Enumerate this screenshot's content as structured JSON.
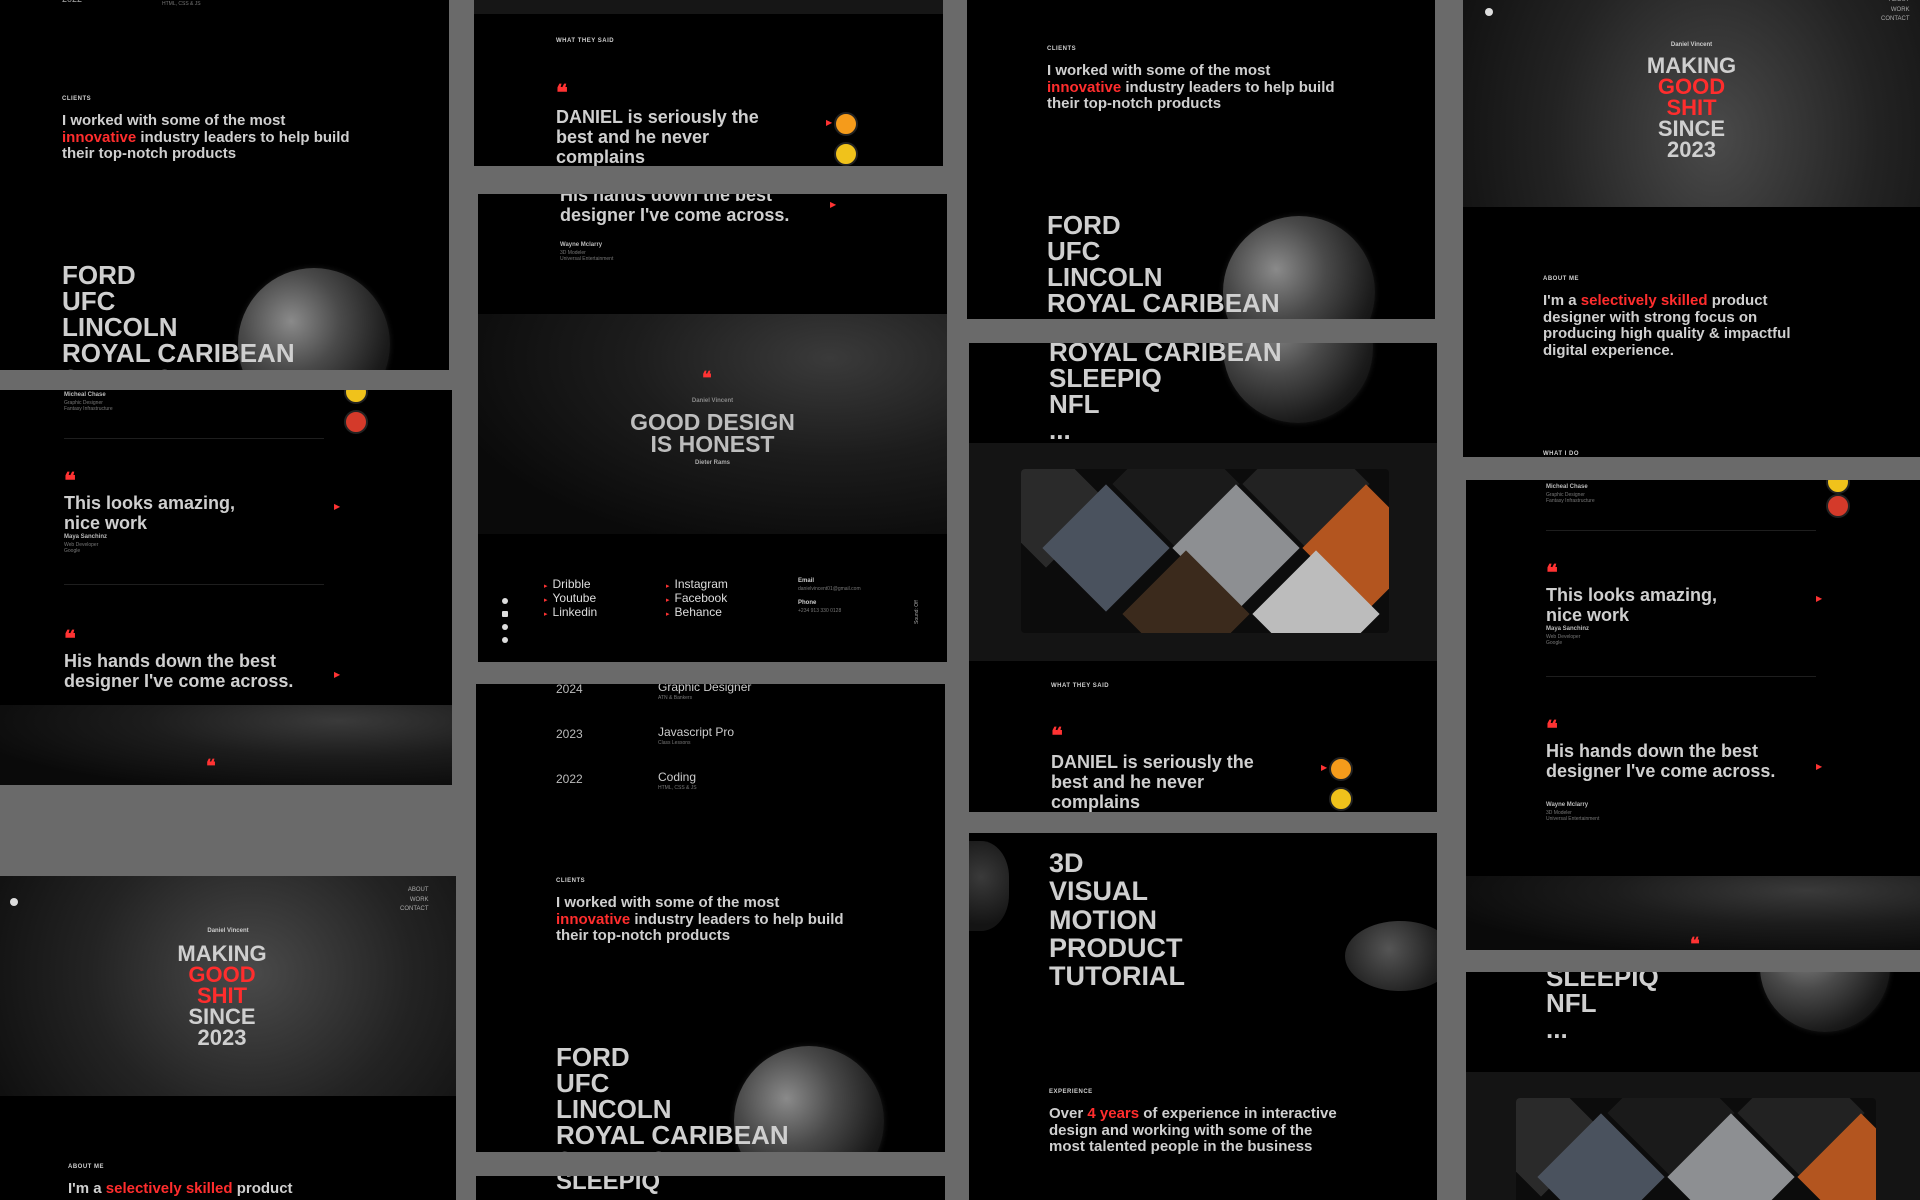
{
  "name": "Daniel Vincent",
  "labels": {
    "clients": "CLIENTS",
    "testimonials": "WHAT THEY SAID",
    "about": "ABOUT ME",
    "what_i_do": "WHAT I DO",
    "experience": "EXPERIENCE"
  },
  "clients_intro": {
    "pre": "I worked with some of the most",
    "highlight": "innovative",
    "post": "industry leaders to help build their top-notch products"
  },
  "clients": [
    "FORD",
    "UFC",
    "LINCOLN",
    "ROYAL CARIBEAN",
    "SLEEPIQ",
    "NFL"
  ],
  "ellipsis": "...",
  "quote_bits": {
    "daniel": "DANIEL is seriously the best and he never complains",
    "amazing": "This looks amazing, nice work",
    "best": "His hands down the best designer I've come across."
  },
  "people": {
    "micheal": {
      "name": "Micheal Chase",
      "role": "Graphic Designer",
      "company": "Fantasy Infrastructure"
    },
    "maya": {
      "name": "Maya Sanchinz",
      "role": "Web Developer",
      "company": "Google"
    },
    "wayne": {
      "name": "Wayne Mclarry",
      "role": "3D Modeler",
      "company": "Universal Entertainment"
    }
  },
  "motto": {
    "line1": "GOOD DESIGN",
    "line2": "IS HONEST",
    "author": "Dieter Rams"
  },
  "footer": {
    "col1": [
      "Dribble",
      "Youtube",
      "Linkedin"
    ],
    "col2": [
      "Instagram",
      "Facebook",
      "Behance"
    ],
    "email_label": "Email",
    "email": "danielvincent01@gmail.com",
    "phone_label": "Phone",
    "phone": "+234 913 330 0128",
    "sound": "Sound: Off"
  },
  "timeline": [
    {
      "year": "2024",
      "title": "Graphic Designer",
      "sub": "ATN & Bankers"
    },
    {
      "year": "2023",
      "title": "Javascript Pro",
      "sub": "Class Lessons"
    },
    {
      "year": "2022",
      "title": "Coding",
      "sub": "HTML, CSS & JS"
    }
  ],
  "top_fragment": {
    "year": "2022",
    "sub": "HTML, CSS & JS"
  },
  "hero": {
    "making": "MAKING",
    "good": "GOOD",
    "shit": "SHIT",
    "since": "SINCE",
    "year": "2023"
  },
  "nav": [
    "ABOUT",
    "WORK",
    "CONTACT"
  ],
  "about": {
    "pre": "I'm a",
    "highlight": "selectively skilled",
    "post": "product designer with strong focus on producing high quality & impactful digital experience."
  },
  "about_short": {
    "pre": "I'm a",
    "highlight": "selectively skilled",
    "post": "product"
  },
  "services": [
    "3D",
    "VISUAL",
    "MOTION",
    "PRODUCT",
    "TUTORIAL"
  ],
  "experience": {
    "pre": "Over",
    "highlight": "4 years",
    "post": "of experience in interactive design and working with some of the most talented people in the business"
  },
  "colors": {
    "accent": "#ff2d2d",
    "gutter": "#6a6a6a",
    "board": "#000000"
  }
}
